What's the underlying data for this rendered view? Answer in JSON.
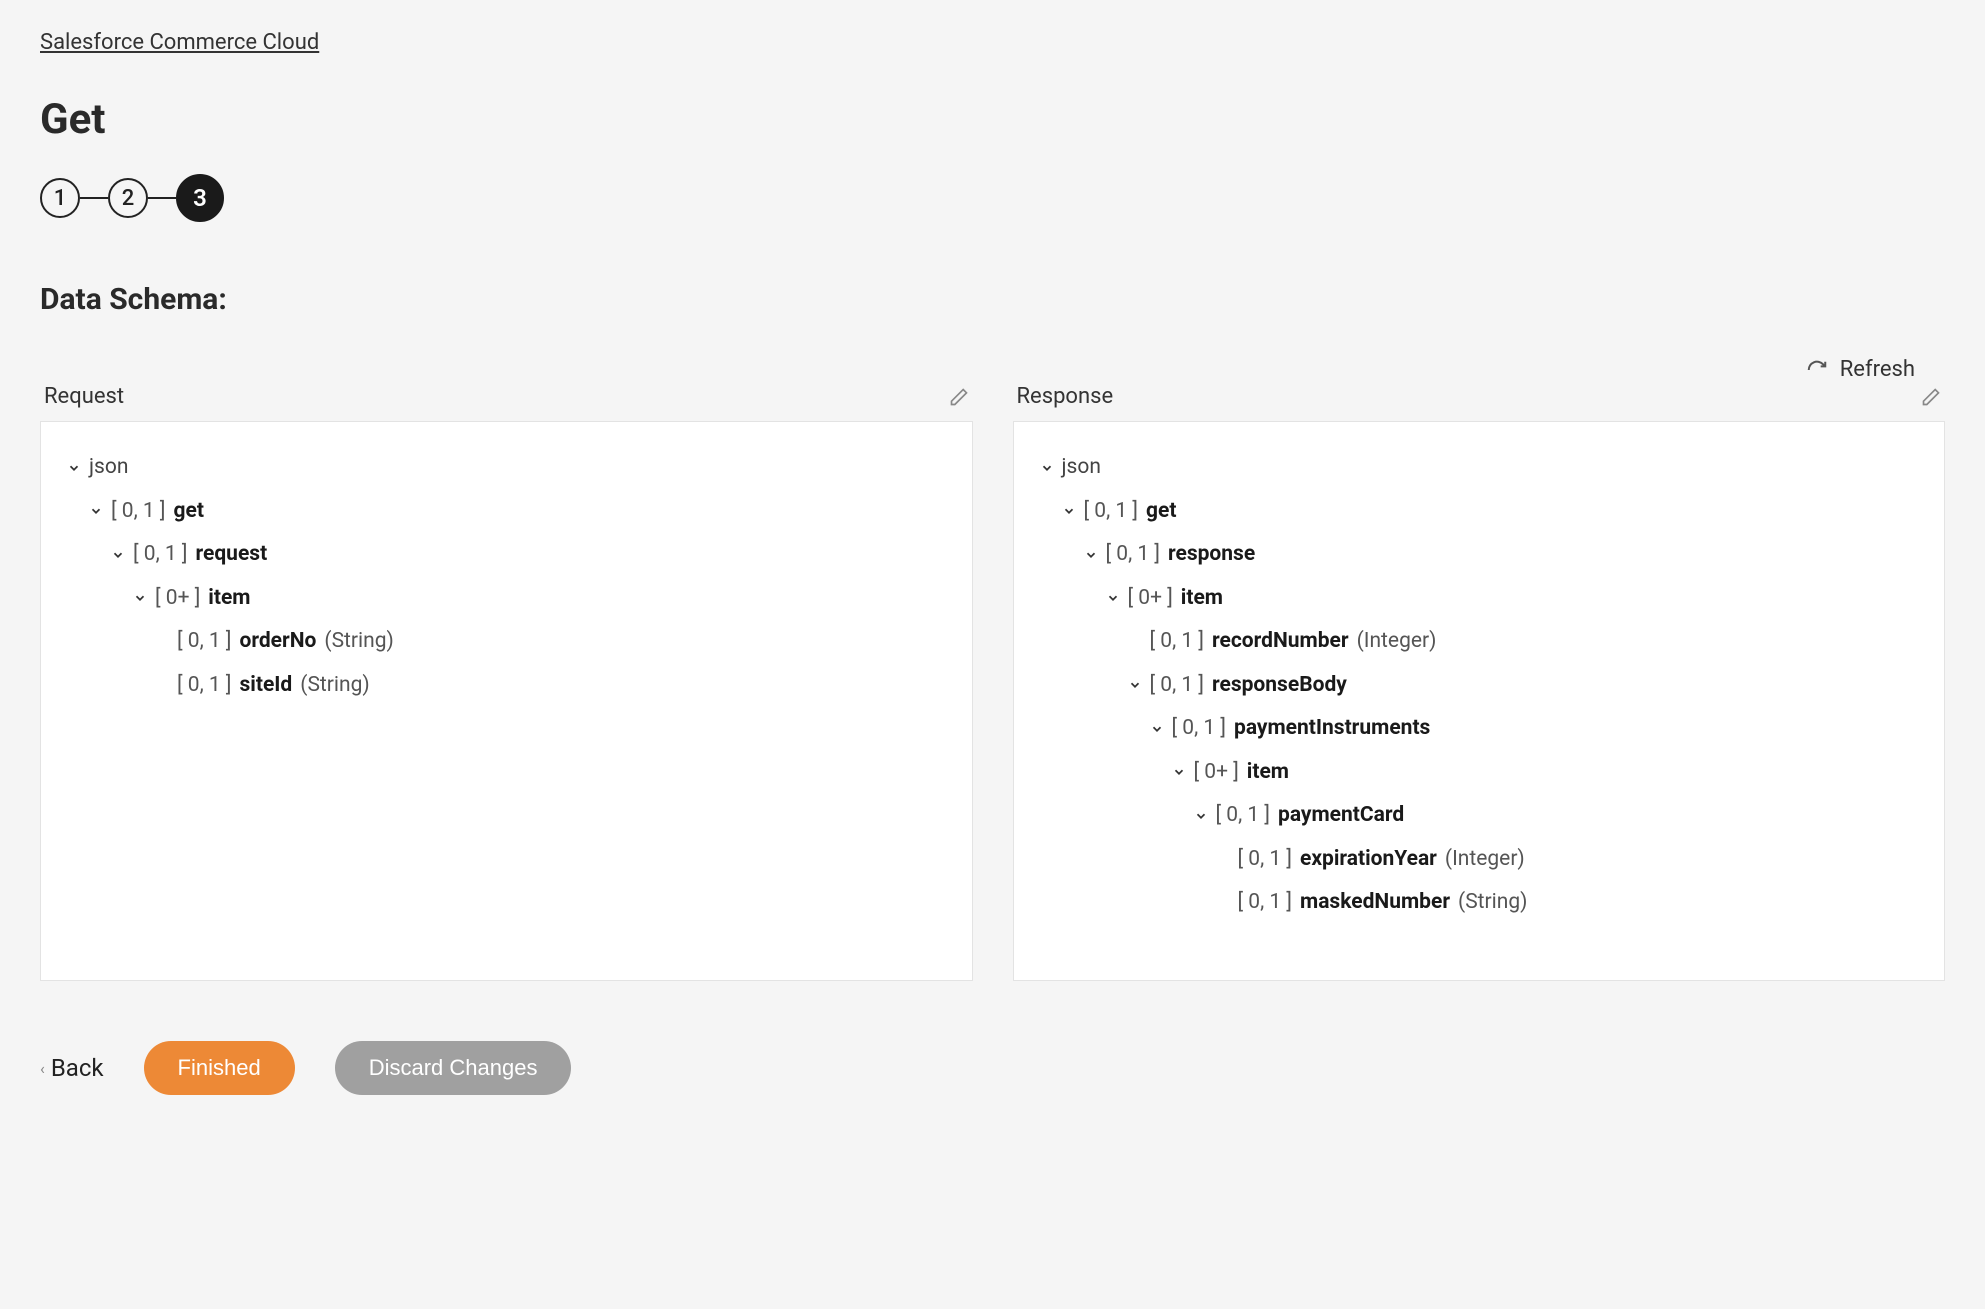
{
  "breadcrumb": "Salesforce Commerce Cloud",
  "page_title": "Get",
  "stepper": {
    "steps": [
      "1",
      "2",
      "3"
    ],
    "active_index": 2
  },
  "section_title": "Data Schema:",
  "refresh_label": "Refresh",
  "panels": {
    "request_label": "Request",
    "response_label": "Response"
  },
  "request_tree": [
    {
      "indent": 0,
      "chev": true,
      "card": "",
      "field": "json",
      "type": "",
      "field_weight": "normal"
    },
    {
      "indent": 1,
      "chev": true,
      "card": "[ 0, 1 ]",
      "field": "get",
      "type": ""
    },
    {
      "indent": 2,
      "chev": true,
      "card": "[ 0, 1 ]",
      "field": "request",
      "type": ""
    },
    {
      "indent": 3,
      "chev": true,
      "card": "[ 0+ ]",
      "field": "item",
      "type": ""
    },
    {
      "indent": 4,
      "chev": false,
      "card": "[ 0, 1 ]",
      "field": "orderNo",
      "type": "(String)"
    },
    {
      "indent": 4,
      "chev": false,
      "card": "[ 0, 1 ]",
      "field": "siteId",
      "type": "(String)"
    }
  ],
  "response_tree": [
    {
      "indent": 0,
      "chev": true,
      "card": "",
      "field": "json",
      "type": "",
      "field_weight": "normal"
    },
    {
      "indent": 1,
      "chev": true,
      "card": "[ 0, 1 ]",
      "field": "get",
      "type": ""
    },
    {
      "indent": 2,
      "chev": true,
      "card": "[ 0, 1 ]",
      "field": "response",
      "type": ""
    },
    {
      "indent": 3,
      "chev": true,
      "card": "[ 0+ ]",
      "field": "item",
      "type": ""
    },
    {
      "indent": 4,
      "chev": false,
      "card": "[ 0, 1 ]",
      "field": "recordNumber",
      "type": "(Integer)"
    },
    {
      "indent": 4,
      "chev": true,
      "card": "[ 0, 1 ]",
      "field": "responseBody",
      "type": ""
    },
    {
      "indent": 5,
      "chev": true,
      "card": "[ 0, 1 ]",
      "field": "paymentInstruments",
      "type": ""
    },
    {
      "indent": 6,
      "chev": true,
      "card": "[ 0+ ]",
      "field": "item",
      "type": ""
    },
    {
      "indent": 7,
      "chev": true,
      "card": "[ 0, 1 ]",
      "field": "paymentCard",
      "type": ""
    },
    {
      "indent": 8,
      "chev": false,
      "card": "[ 0, 1 ]",
      "field": "expirationYear",
      "type": "(Integer)"
    },
    {
      "indent": 8,
      "chev": false,
      "card": "[ 0, 1 ]",
      "field": "maskedNumber",
      "type": "(String)"
    }
  ],
  "footer": {
    "back": "Back",
    "finished": "Finished",
    "discard": "Discard Changes"
  }
}
